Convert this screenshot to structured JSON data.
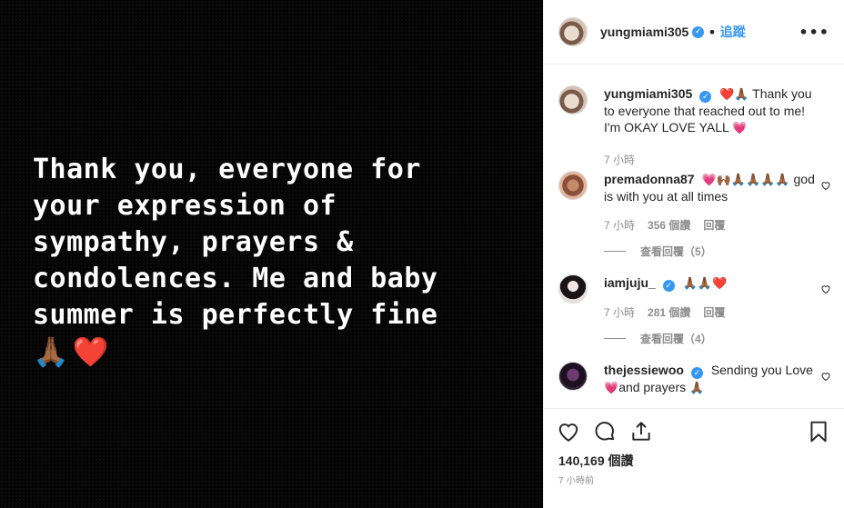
{
  "story": {
    "text": "Thank you, everyone for\nyour expression of\nsympathy, prayers &\ncondolences. Me and baby\nsummer is perfectly fine",
    "emoji": [
      "🙏🏾",
      "❤️"
    ]
  },
  "header": {
    "username": "yungmiami305",
    "follow_label": "追蹤",
    "separator": "•",
    "more_label": "•••"
  },
  "caption": {
    "username": "yungmiami305",
    "emoji_lead": "❤️🙏🏾",
    "text": "Thank you to everyone that reached out to me! I'm OKAY LOVE YALL",
    "emoji_tail": "💗",
    "time": "7 小時"
  },
  "comments": [
    {
      "username": "premadonna87",
      "emoji_lead": "💗🙌🏾🙏🏾🙏🏾🙏🏾🙏🏾",
      "text": "god is with you at all times",
      "time": "7 小時",
      "likes": "356 個讚",
      "reply": "回覆",
      "view_replies": "查看回覆（5）"
    },
    {
      "username": "iamjuju_",
      "emoji_lead": "🙏🏾🙏🏾❤️",
      "text": "",
      "time": "7 小時",
      "likes": "281 個讚",
      "reply": "回覆",
      "view_replies": "查看回覆（4）"
    },
    {
      "username": "thejessiewoo",
      "text": "Sending you Love",
      "emoji_mid": "💗",
      "text2": "and prayers",
      "emoji_tail": "🙏🏾"
    }
  ],
  "footer": {
    "likes_count": "140,169 個讚",
    "posted_time": "7 小時前"
  },
  "colors": {
    "accent": "#3897f0",
    "heart": "#ed2939",
    "muted": "#8e8e8e"
  },
  "icons": [
    "heart-icon",
    "comment-icon",
    "share-icon",
    "bookmark-icon",
    "verified-badge-icon",
    "more-options-icon"
  ]
}
